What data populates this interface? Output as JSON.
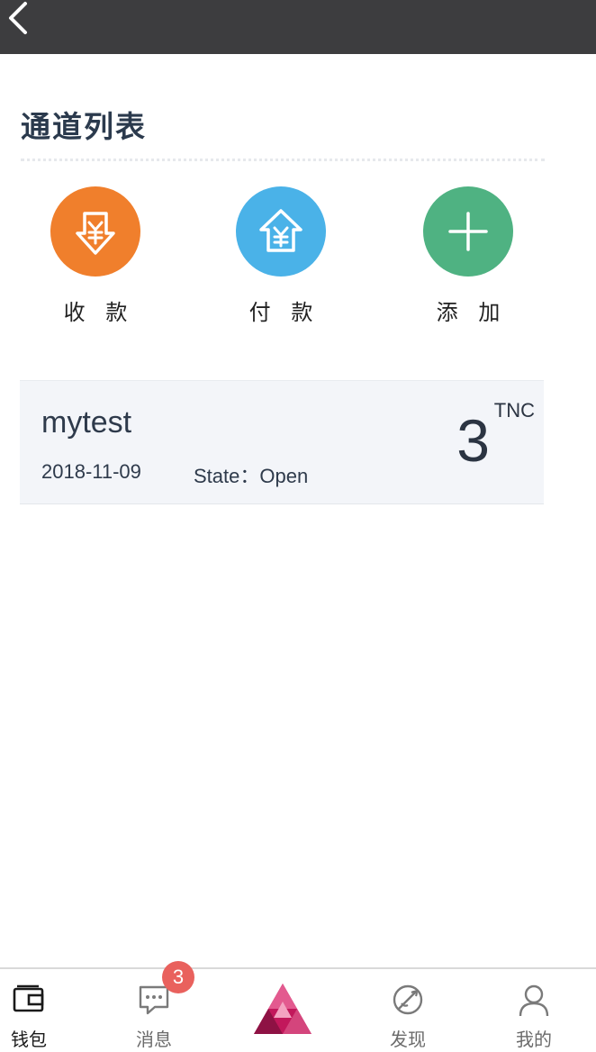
{
  "header": {
    "back_icon": "chevron-left-icon",
    "bg_color": "#3d3d3f"
  },
  "section": {
    "title": "通道列表"
  },
  "actions": [
    {
      "label": "收 款",
      "icon": "receive-yen-icon",
      "color": "#f07f2c"
    },
    {
      "label": "付 款",
      "icon": "pay-yen-icon",
      "color": "#4ab2e8"
    },
    {
      "label": "添 加",
      "icon": "plus-icon",
      "color": "#4fb282"
    }
  ],
  "channels": [
    {
      "name": "mytest",
      "date": "2018-11-09",
      "state_text": "State：Open",
      "amount": "3",
      "unit": "TNC"
    }
  ],
  "bottom_nav": {
    "items": [
      {
        "label": "钱包",
        "icon": "wallet-icon",
        "active": true
      },
      {
        "label": "消息",
        "icon": "message-icon",
        "badge": "3"
      },
      {
        "label": "",
        "icon": "trinity-logo-icon"
      },
      {
        "label": "发现",
        "icon": "discover-icon"
      },
      {
        "label": "我的",
        "icon": "profile-icon"
      }
    ]
  },
  "colors": {
    "badge": "#e9615d",
    "text_dark": "#2e3a4b"
  }
}
